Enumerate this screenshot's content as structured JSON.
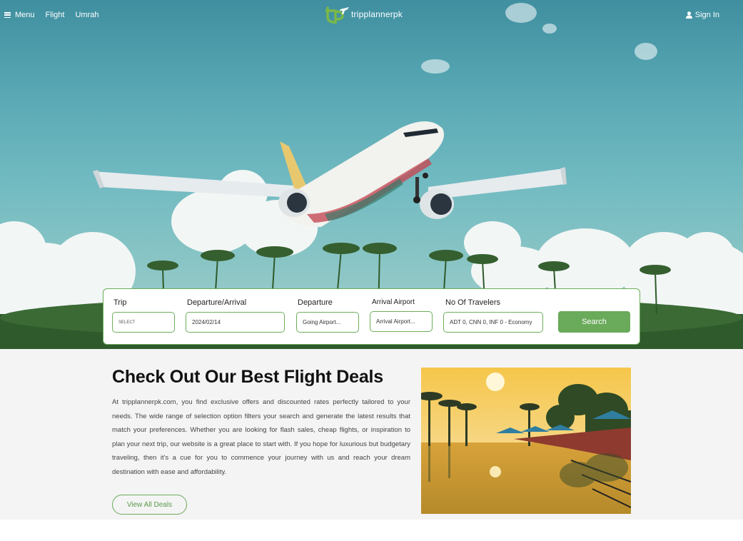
{
  "nav": {
    "menu_label": "Menu",
    "links": [
      "Flight",
      "Umrah"
    ],
    "logo_text": "tripplannerpk",
    "signin_label": "Sign In"
  },
  "search": {
    "trip": {
      "label": "Trip",
      "value": "SELECT"
    },
    "date": {
      "label": "Departure/Arrival",
      "value": "2024/02/14"
    },
    "departure": {
      "label": "Departure",
      "value": "Going Airport..."
    },
    "arrival": {
      "label": "Arrival Airport",
      "value": "Arrival Airport..."
    },
    "travelers": {
      "label": "No Of Travelers",
      "value": "ADT 0, CNN 0, INF 0 - Economy"
    },
    "button_label": "Search"
  },
  "deals": {
    "title": "Check Out Our Best Flight Deals",
    "text": "At tripplannerpk.com, you find exclusive offers and discounted rates perfectly tailored to your needs. The wide range of selection option filters your search and generate the latest results that match your preferences. Whether you are looking for flash sales, cheap flights, or inspiration to plan your next trip, our website is a great place to start with. If you hope for luxurious but budgetary traveling, then it's a cue for you to commence your journey with us and reach your dream destination with ease and affordability.",
    "button_label": "View All Deals"
  },
  "colors": {
    "brand_green": "#6aaa5b",
    "sky": "#5aa9b5"
  },
  "icons": [
    "hamburger-icon",
    "logo-icon",
    "user-icon"
  ]
}
